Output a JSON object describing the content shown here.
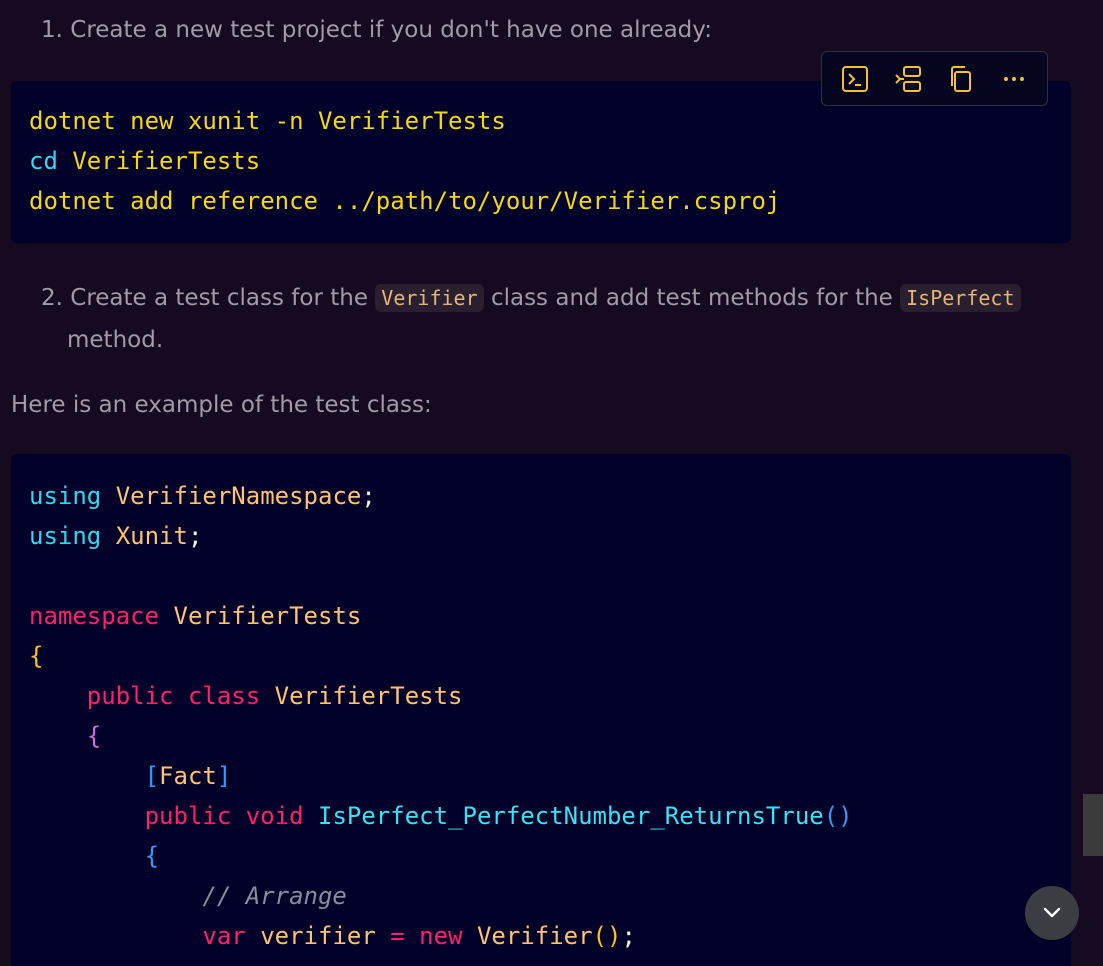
{
  "steps": [
    {
      "number": "1.",
      "text": "Create a new test project if you don't have one already:"
    },
    {
      "number": "2.",
      "text_before": "Create a test class for the",
      "code1": "Verifier",
      "text_middle": "class and add test methods for the",
      "code2": "IsPerfect",
      "text_after": "method."
    }
  ],
  "paragraph": "Here is an example of the test class:",
  "toolbar": {
    "buttons": [
      {
        "icon": "terminal-icon",
        "label": "Run in terminal"
      },
      {
        "icon": "insert-icon",
        "label": "Insert"
      },
      {
        "icon": "copy-icon",
        "label": "Copy"
      },
      {
        "icon": "more-icon",
        "label": "More actions"
      }
    ]
  },
  "code_block_1": {
    "lines": [
      [
        {
          "t": "dotnet new xunit -n VerifierTests",
          "c": "yellow"
        }
      ],
      [
        {
          "t": "cd",
          "c": "cyan"
        },
        {
          "t": " VerifierTests",
          "c": "yellow"
        }
      ],
      [
        {
          "t": "dotnet add reference ../path/to/your/Verifier.csproj",
          "c": "yellow"
        }
      ]
    ]
  },
  "code_block_2": {
    "lines": [
      [
        {
          "t": "using",
          "c": "cyan"
        },
        {
          "t": " VerifierNamespace",
          "c": "orange"
        },
        {
          "t": ";",
          "c": "white"
        }
      ],
      [
        {
          "t": "using",
          "c": "cyan"
        },
        {
          "t": " Xunit",
          "c": "orange"
        },
        {
          "t": ";",
          "c": "white"
        }
      ],
      [
        {
          "t": "",
          "c": "white"
        }
      ],
      [
        {
          "t": "namespace",
          "c": "red"
        },
        {
          "t": " VerifierTests",
          "c": "orange"
        }
      ],
      [
        {
          "t": "{",
          "c": "gold"
        }
      ],
      [
        {
          "t": "    public",
          "c": "red"
        },
        {
          "t": " class",
          "c": "red"
        },
        {
          "t": " VerifierTests",
          "c": "orange"
        }
      ],
      [
        {
          "t": "    {",
          "c": "magenta"
        }
      ],
      [
        {
          "t": "        [",
          "c": "blue"
        },
        {
          "t": "Fact",
          "c": "orange"
        },
        {
          "t": "]",
          "c": "blue"
        }
      ],
      [
        {
          "t": "        public",
          "c": "red"
        },
        {
          "t": " void",
          "c": "red"
        },
        {
          "t": " IsPerfect_PerfectNumber_ReturnsTrue",
          "c": "green"
        },
        {
          "t": "()",
          "c": "blue"
        }
      ],
      [
        {
          "t": "        {",
          "c": "blue"
        }
      ],
      [
        {
          "t": "            // Arrange",
          "c": "comment"
        }
      ],
      [
        {
          "t": "            var",
          "c": "red"
        },
        {
          "t": " verifier",
          "c": "orange"
        },
        {
          "t": " =",
          "c": "red"
        },
        {
          "t": " new",
          "c": "red"
        },
        {
          "t": " Verifier",
          "c": "orange"
        },
        {
          "t": "()",
          "c": "gold"
        },
        {
          "t": ";",
          "c": "white"
        }
      ]
    ]
  },
  "colors": {
    "background": "#150a20",
    "code_background": "#000028",
    "toolbar_icon": "#f2c230"
  }
}
